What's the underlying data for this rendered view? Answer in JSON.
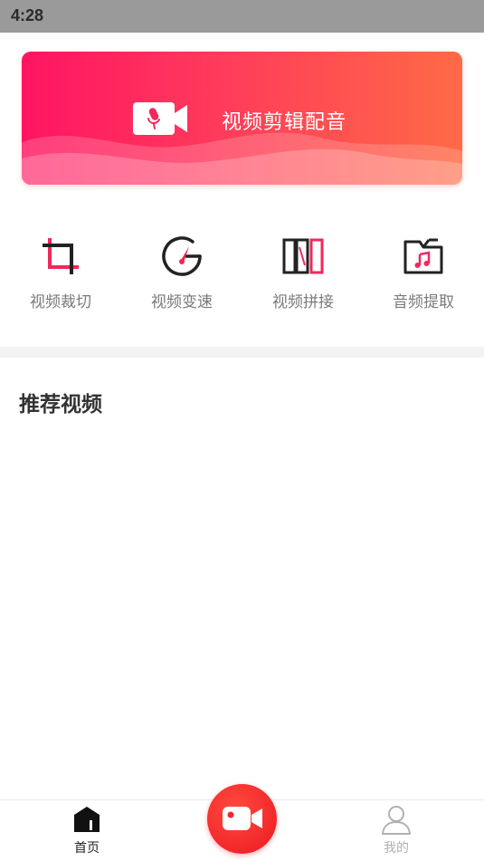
{
  "status_bar": {
    "time": "4:28"
  },
  "banner": {
    "title": "视频剪辑配音",
    "icon": "video-mic-icon"
  },
  "tools": [
    {
      "label": "视频裁切",
      "icon": "crop-icon"
    },
    {
      "label": "视频变速",
      "icon": "speedometer-icon"
    },
    {
      "label": "视频拼接",
      "icon": "splice-icon"
    },
    {
      "label": "音频提取",
      "icon": "music-folder-icon"
    }
  ],
  "section": {
    "title": "推荐视频"
  },
  "bottom_nav": {
    "home_label": "首页",
    "mine_label": "我的",
    "record_icon": "video-camera-icon"
  },
  "colors": {
    "accent": "#f2275a",
    "banner_start": "#ff1462",
    "banner_end": "#ff6a45",
    "record_button": "#f2272a",
    "status_bar": "#9a9a9a"
  }
}
